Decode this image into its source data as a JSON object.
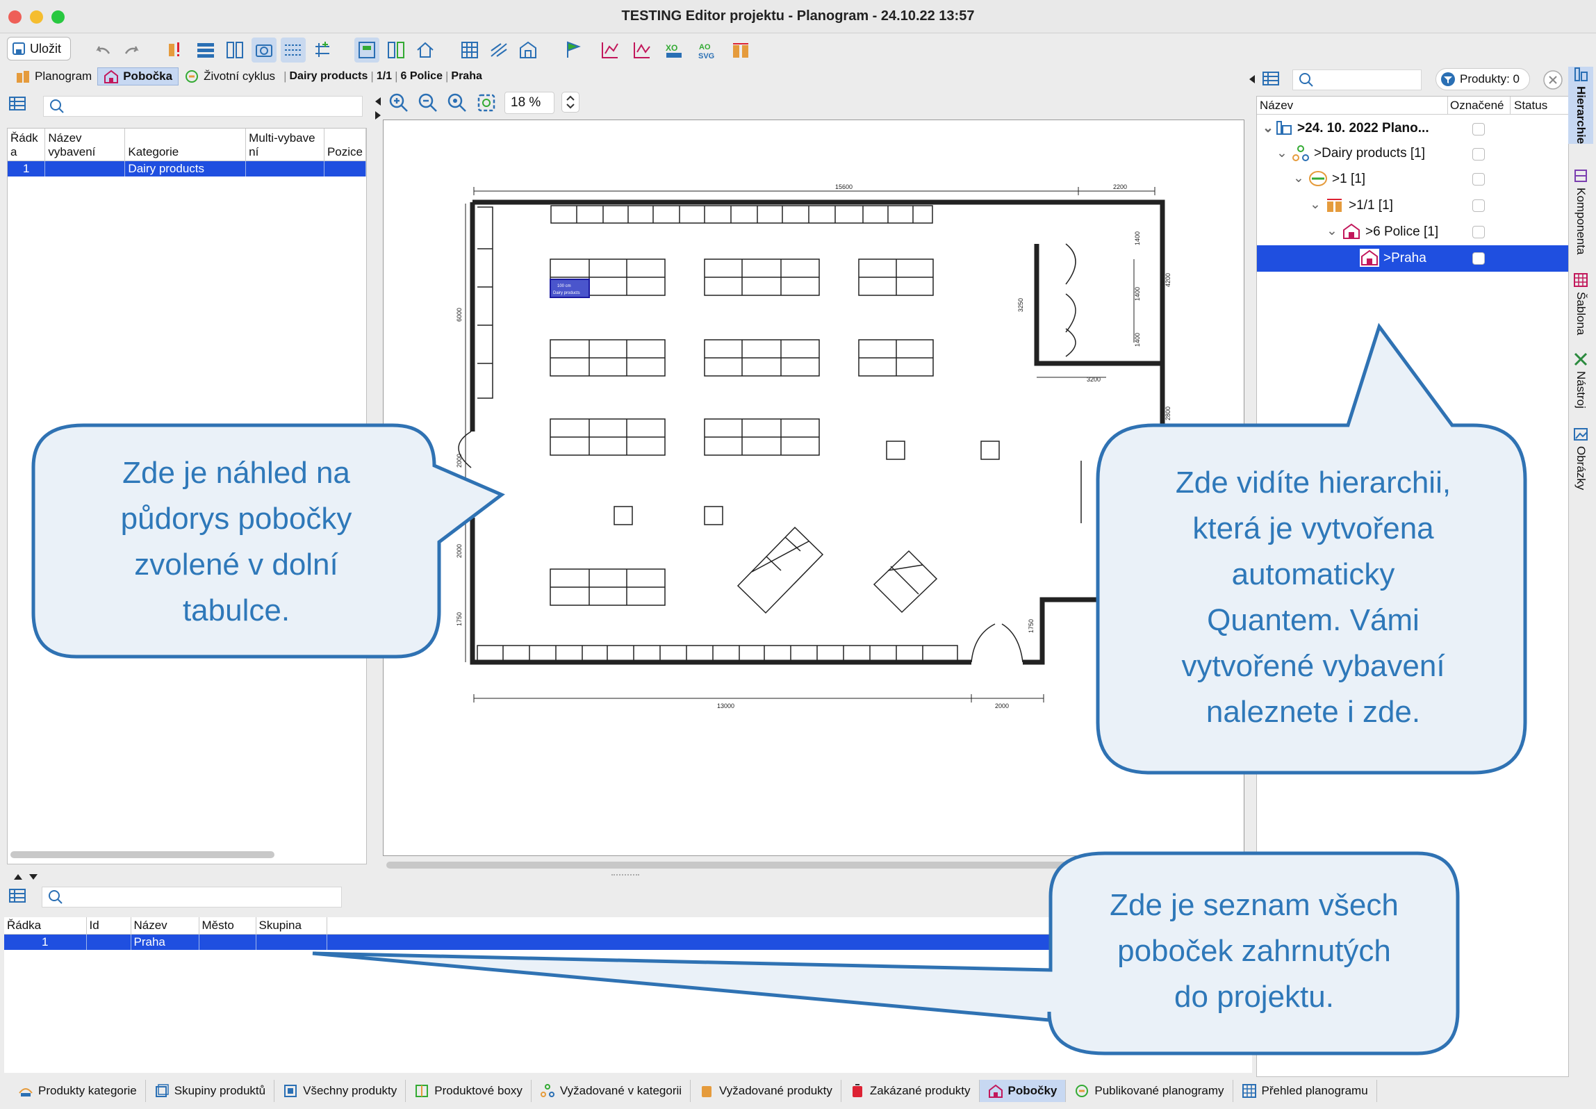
{
  "window": {
    "title": "TESTING Editor projektu - Planogram - 24.10.22 13:57"
  },
  "toolbar": {
    "save_label": "Uložit"
  },
  "nav": {
    "tabs": [
      {
        "label": "Planogram"
      },
      {
        "label": "Pobočka"
      },
      {
        "label": "Životní cyklus"
      }
    ],
    "breadcrumb": [
      "Dairy products",
      "1/1",
      "6 Police",
      "Praha"
    ]
  },
  "left_table": {
    "headers": [
      "Řádk\na",
      "Název\nvybavení",
      "Kategorie",
      "Multi-vybave\nní",
      "Pozice"
    ],
    "rows": [
      {
        "row": "1",
        "name": "",
        "category": "Dairy products",
        "multi": "",
        "position": ""
      }
    ]
  },
  "canvas": {
    "zoom": "18 %",
    "dimensions": {
      "top_left": "15600",
      "top_right": "2200",
      "bottom_left": "13000",
      "bottom_right": "2000",
      "right_room": "3200",
      "v_left_1": "6000",
      "v_left_2": "2000",
      "v_left_3": "400",
      "v_left_4": "2000",
      "v_left_5": "1750",
      "v_right_1": "1400",
      "v_right_2": "1400",
      "v_right_3": "1400",
      "v_right_4": "4200",
      "v_right_5": "3250",
      "v_right_6": "2800",
      "v_right_7": "1750"
    },
    "selected_shelf": {
      "line1": "100 cm",
      "line2": "Dairy products"
    }
  },
  "right_panel": {
    "products_label": "Produkty: 0",
    "headers": [
      "Název",
      "Označené",
      "Status"
    ],
    "tree": [
      {
        "label": ">24. 10. 2022 Plano..."
      },
      {
        "label": ">Dairy products [1]"
      },
      {
        "label": ">1 [1]"
      },
      {
        "label": ">1/1 [1]"
      },
      {
        "label": ">6 Police [1]"
      },
      {
        "label": ">Praha"
      }
    ]
  },
  "vertical_tabs": [
    "Hierarchie",
    "Komponenta",
    "Šablona",
    "Nástroj",
    "Obrázky"
  ],
  "bottom_table": {
    "headers": [
      "Řádka",
      "Id",
      "Název",
      "Město",
      "Skupina"
    ],
    "rows": [
      {
        "row": "1",
        "id": "",
        "name": "Praha",
        "city": "",
        "group": ""
      }
    ]
  },
  "callouts": {
    "left": [
      "Zde je náhled na",
      "půdorys pobočky",
      "zvolené v dolní",
      "tabulce."
    ],
    "right": [
      "Zde vidíte hierarchii,",
      "která je vytvořena",
      "automaticky",
      "Quantem. Vámi",
      "vytvořené vybavení",
      "naleznete i zde."
    ],
    "bottom": [
      "Zde je seznam všech",
      "poboček zahrnutých",
      "do projektu."
    ]
  },
  "bottom_tabs": [
    {
      "label": "Produkty kategorie"
    },
    {
      "label": "Skupiny produktů"
    },
    {
      "label": "Všechny produkty"
    },
    {
      "label": "Produktové boxy"
    },
    {
      "label": "Vyžadované v kategorii"
    },
    {
      "label": "Vyžadované produkty"
    },
    {
      "label": "Zakázané produkty"
    },
    {
      "label": "Pobočky"
    },
    {
      "label": "Publikované planogramy"
    },
    {
      "label": "Přehled planogramu"
    }
  ],
  "colors": {
    "selection": "#1f4fe0",
    "callout_border": "#2f72b3",
    "callout_fill": "#eaf1f8",
    "callout_text": "#2e78b9"
  }
}
